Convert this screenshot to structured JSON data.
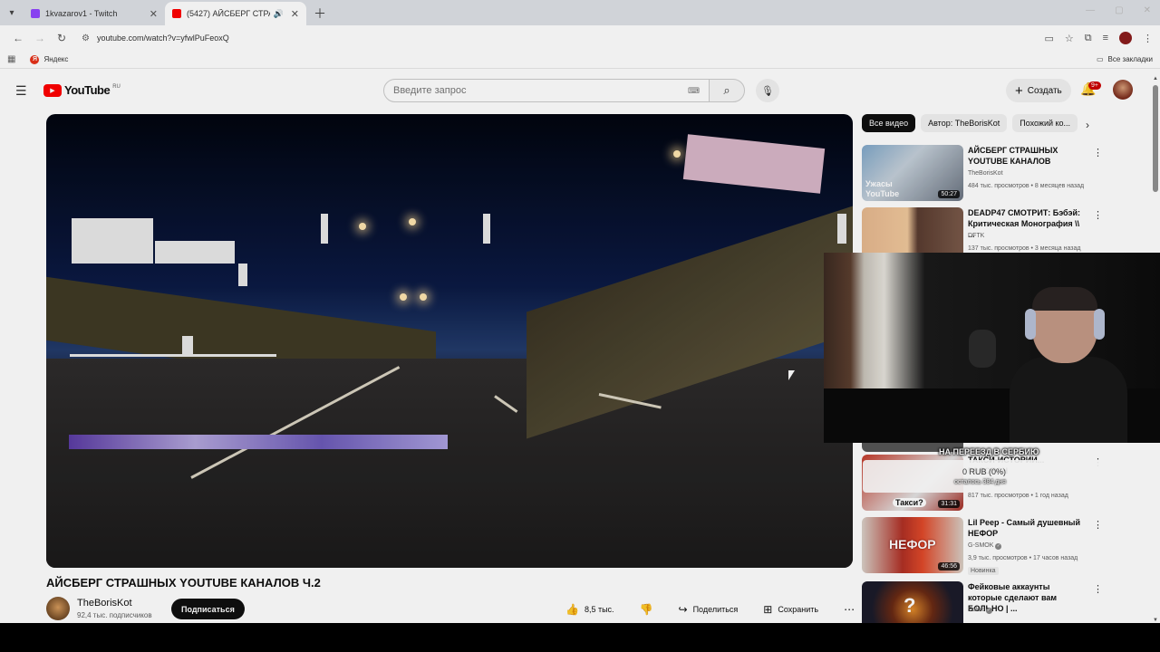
{
  "browser": {
    "tabs": [
      {
        "title": "1kvazarov1 - Twitch",
        "favicon_color": "#9146ff"
      },
      {
        "title": "(5427) АЙСБЕРГ СТРАШНЫ...",
        "favicon_color": "#ff0000"
      }
    ],
    "url": "youtube.com/watch?v=yfwlPuFeoxQ",
    "bookmarks": {
      "yandex": "Яндекс",
      "all": "Все закладки"
    }
  },
  "youtube": {
    "logo_text": "YouTube",
    "region": "RU",
    "search_placeholder": "Введите запрос",
    "create_label": "Создать",
    "notif_count": "9+",
    "video": {
      "title": "АЙСБЕРГ СТРАШНЫХ YOUTUBE КАНАЛОВ Ч.2",
      "channel": "TheBorisKot",
      "subs": "92,4 тыс. подписчиков",
      "subscribe": "Подписаться",
      "likes": "8,5 тыс.",
      "share": "Поделиться",
      "save": "Сохранить"
    },
    "chips": [
      "Все видео",
      "Автор: TheBorisKot",
      "Похожий ко..."
    ],
    "recommendations": [
      {
        "title": "АЙСБЕРГ СТРАШНЫХ YOUTUBE КАНАЛОВ",
        "channel": "TheBorisKot",
        "meta": "484 тыс. просмотров • 8 месяцев назад",
        "duration": "50:27",
        "thumb_caption": "Ужасы YouTube"
      },
      {
        "title": "DEADP47 СМОТРИТ: Бэбэй: Критическая Монография \\\\ ...",
        "channel": "DFTK",
        "meta": "137 тыс. просмотров • 3 месяца назад",
        "duration": ""
      },
      {
        "title": "ТАКСИ-ИСТОРИИ... ГОЛОВАН",
        "channel": "",
        "meta": "817 тыс. просмотров • 1 год назад",
        "duration": "31:31",
        "thumb_caption": "Такси?"
      },
      {
        "title": "Lil Peep - Самый душевный НЕФОР",
        "channel": "G-SMOK",
        "meta": "3,9 тыс. просмотров • 17 часов назад",
        "duration": "46:56",
        "badge": "Новинка",
        "thumb_caption": "НЕФОР"
      },
      {
        "title": "Фейковые аккаунты которые сделают вам БОЛЬНО | ...",
        "channel": "Solek",
        "meta": "",
        "duration": ""
      }
    ]
  },
  "donation": {
    "title": "НА ПЕРЕЕЗД В СЕРБИЮ",
    "amount": "0 RUB (0%)",
    "remaining": "осталось 384 дня"
  }
}
